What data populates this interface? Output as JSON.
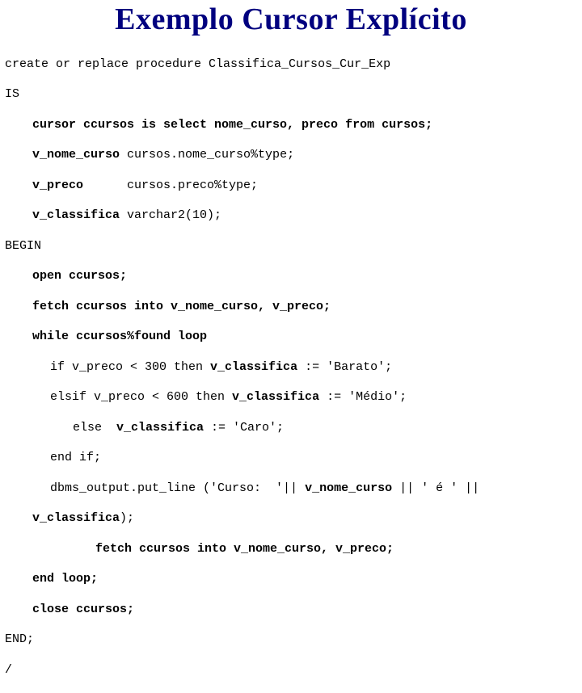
{
  "title": "Exemplo Cursor Explícito",
  "code": {
    "l1": "create or replace procedure Classifica_Cursos_Cur_Exp",
    "l2": "IS",
    "l3": "cursor ccursos is select nome_curso, preco from cursos;",
    "l4a": "v_nome_curso",
    "l4b": " cursos.nome_curso%type;",
    "l5a": "v_preco",
    "l5b": "      cursos.preco%type;",
    "l6a": "v_classifica",
    "l6b": " varchar2(10);",
    "l7": "BEGIN",
    "l8": "open ccursos;",
    "l9": "fetch ccursos into v_nome_curso, v_preco;",
    "l10": "while ccursos%found loop",
    "l11a": "if v_preco < 300 then ",
    "l11b": "v_classifica",
    "l11c": " := 'Barato';",
    "l12a": "elsif v_preco < 600 then ",
    "l12b": "v_classifica",
    "l12c": " := 'Médio';",
    "l13a": "else  ",
    "l13b": "v_classifica",
    "l13c": " := 'Caro';",
    "l14": "end if;",
    "l15a": "dbms_output.put_line ('Curso:  '|| ",
    "l15b": "v_nome_curso",
    "l15c": " || ' é ' || ",
    "l16": "v_classifica",
    "l16b": ");",
    "l17": "fetch ccursos into v_nome_curso, v_preco;",
    "l18": "end loop;",
    "l19": "close ccursos;",
    "l20": "END;",
    "l21": "/"
  }
}
